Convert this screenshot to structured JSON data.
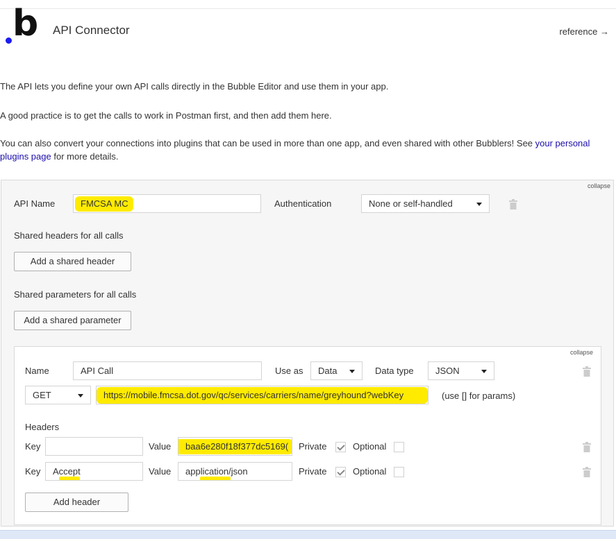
{
  "header": {
    "title": "API Connector",
    "reference_link": "reference →",
    "logo_letter": "b"
  },
  "intro": {
    "p1": "The API lets you define your own API calls directly in the Bubble Editor and use them in your app.",
    "p2": "A good practice is to get the calls to work in Postman first, and then add them here.",
    "p3_before": "You can also convert your connections into plugins that can be used in more than one app, and even shared with other Bubblers! See ",
    "p3_link": "your personal plugins page",
    "p3_after": " for more details."
  },
  "api": {
    "collapse_label": "collapse",
    "name_label": "API Name",
    "name_value": "FMCSA MC",
    "auth_label": "Authentication",
    "auth_value": "None or self-handled",
    "shared_headers_label": "Shared headers for all calls",
    "add_shared_header": "Add a shared header",
    "shared_params_label": "Shared parameters for all calls",
    "add_shared_param": "Add a shared parameter"
  },
  "call": {
    "collapse_label": "collapse",
    "name_label": "Name",
    "name_value": "API Call",
    "use_as_label": "Use as",
    "use_as_value": "Data",
    "data_type_label": "Data type",
    "data_type_value": "JSON",
    "method": "GET",
    "url": "https://mobile.fmcsa.dot.gov/qc/services/carriers/name/greyhound?webKey",
    "params_hint": "(use [] for params)",
    "headers_label": "Headers",
    "headers": [
      {
        "key_label": "Key",
        "key": "",
        "value_label": "Value",
        "value": "baa6e280f18f377dc5169(",
        "private_label": "Private",
        "private": true,
        "optional_label": "Optional",
        "optional": false
      },
      {
        "key_label": "Key",
        "key": "Accept",
        "value_label": "Value",
        "value": "application/json",
        "private_label": "Private",
        "private": true,
        "optional_label": "Optional",
        "optional": false
      }
    ],
    "add_header": "Add header"
  },
  "colors": {
    "highlight": "#ffeb00",
    "link": "#1a0dab",
    "logo_dot": "#1b1bf2"
  },
  "icons": [
    "caret-down-icon",
    "trash-icon",
    "checkmark-icon"
  ]
}
